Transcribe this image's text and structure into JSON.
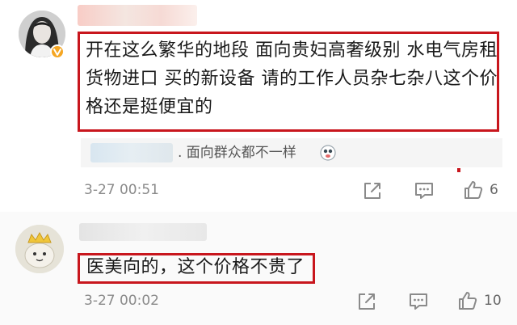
{
  "comments": [
    {
      "text": "开在这么繁华的地段 面向贵妇高奢级别 水电气房租 货物进口 买的新设备 请的工作人员杂七杂八这个价格还是挺便宜的",
      "reply_text": ". 面向群众都不一样",
      "timestamp": "3-27 00:51",
      "likes": "6"
    },
    {
      "text": "医美向的，这个价格不贵了",
      "timestamp": "3-27 00:02",
      "likes": "10"
    }
  ],
  "colors": {
    "highlight_border": "#c8161d",
    "verified_badge": "#f5a623",
    "icon_gray": "#8a8a8a"
  },
  "icons": [
    "share-icon",
    "comment-icon",
    "like-icon",
    "verified-badge-icon",
    "emoji-icon"
  ]
}
